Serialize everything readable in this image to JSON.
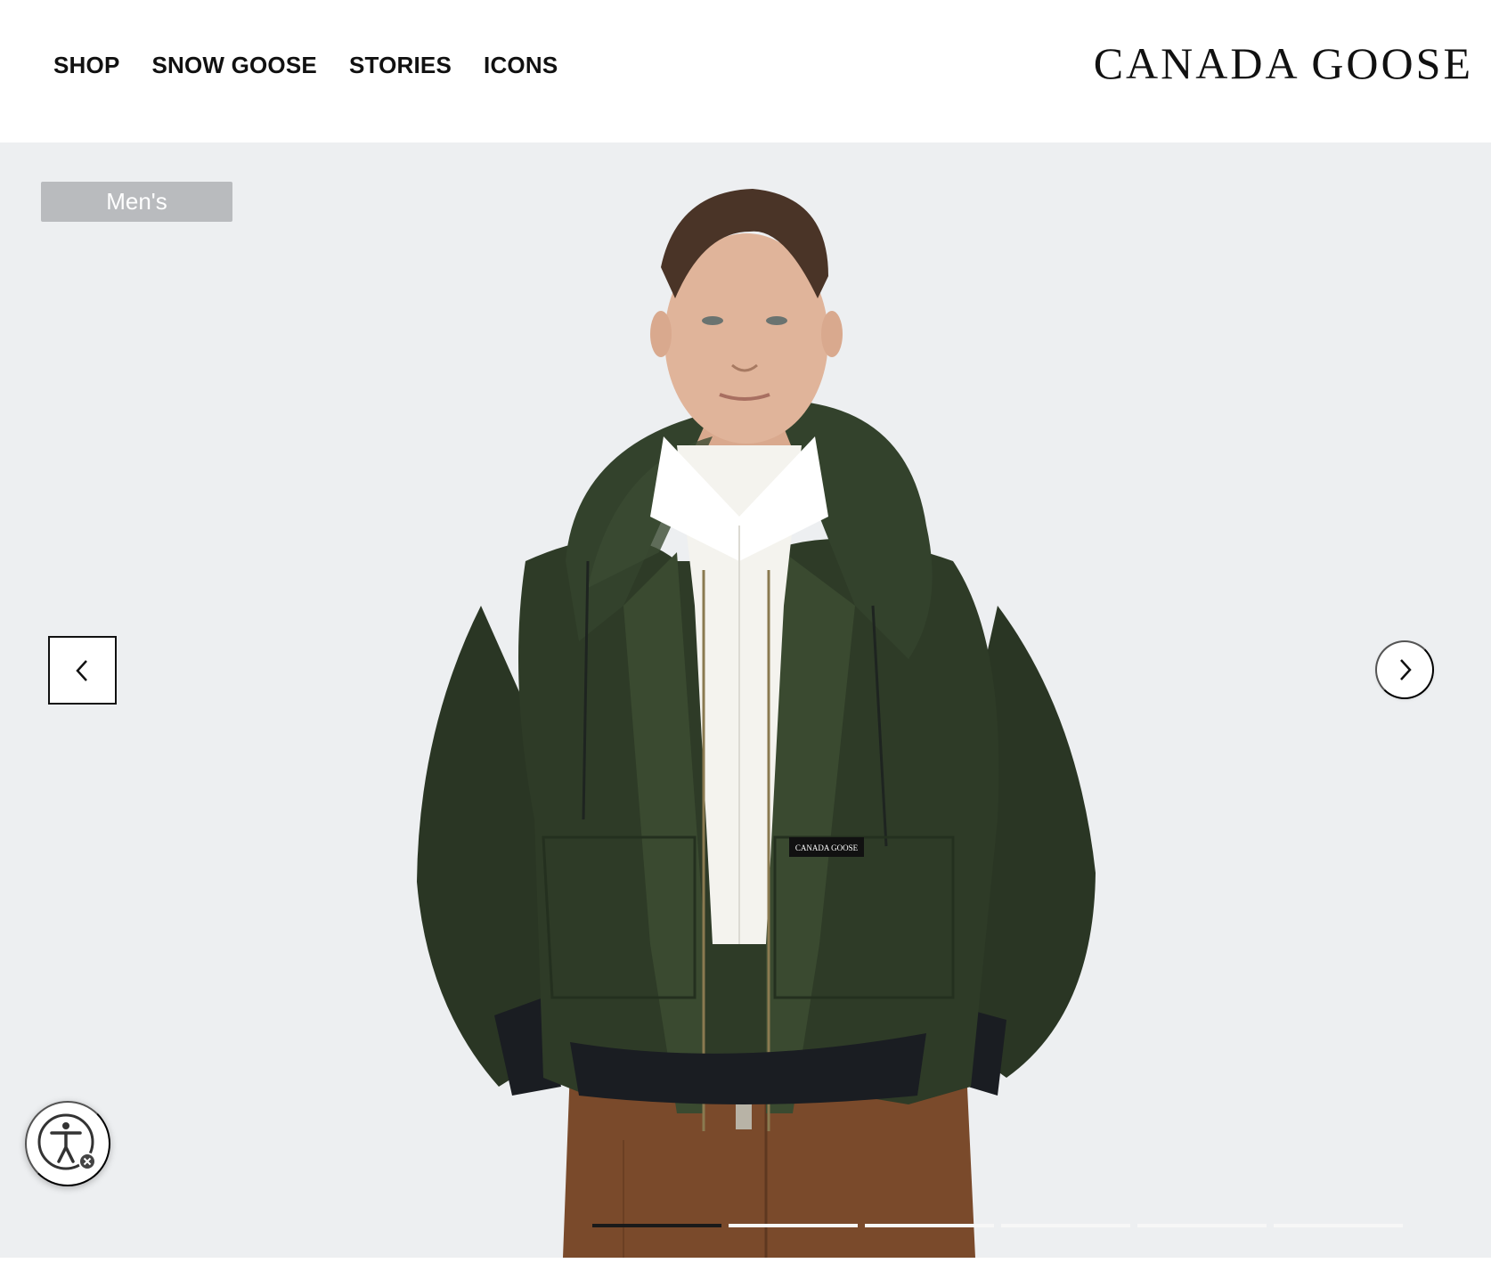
{
  "nav": {
    "items": [
      {
        "label": "SHOP"
      },
      {
        "label": "SNOW GOOSE"
      },
      {
        "label": "STORIES"
      },
      {
        "label": "ICONS"
      }
    ]
  },
  "brand": {
    "logo_text": "CANADA GOOSE"
  },
  "hero": {
    "category_tag": "Men's",
    "badge_text": "CANADA GOOSE",
    "prev_icon": "chevron-left-icon",
    "next_icon": "chevron-right-icon",
    "slides_total": 6,
    "slide_active": 1
  },
  "accessibility": {
    "icon": "accessibility-icon",
    "close_icon": "close-icon"
  },
  "colors": {
    "hero_bg": "#edeff1",
    "jacket": "#2e3b27",
    "shirt": "#f4f3ee",
    "pants": "#7a4a2b",
    "tag_bg": "#b9bbbe"
  }
}
